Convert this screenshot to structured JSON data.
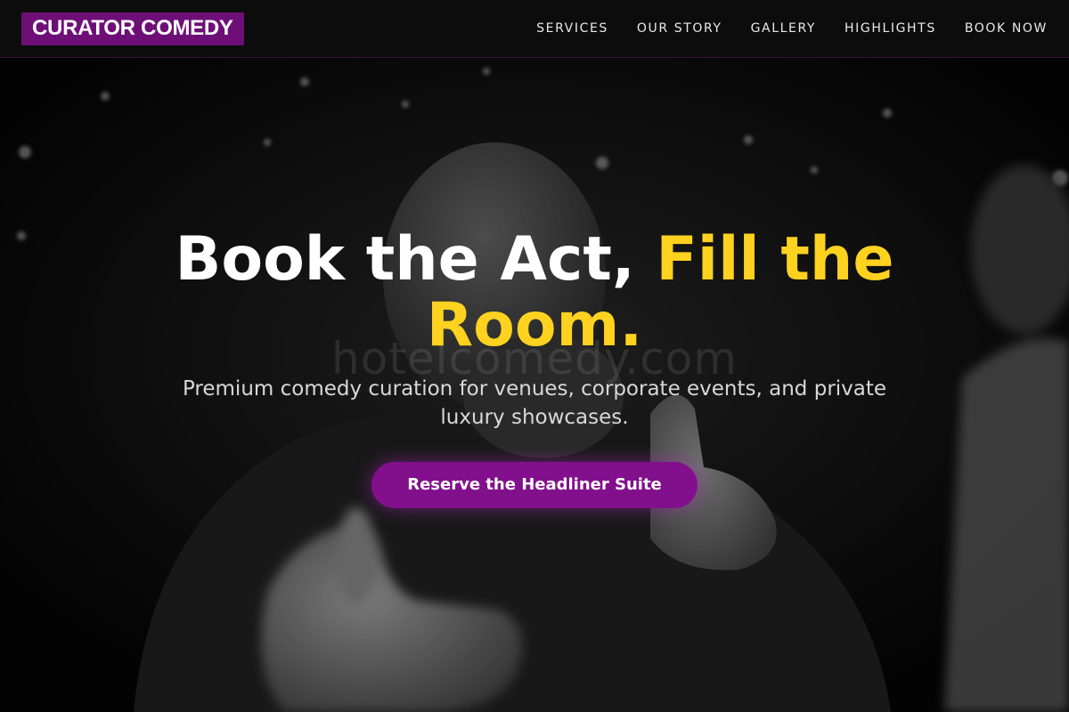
{
  "header": {
    "logo": "CURATOR COMEDY",
    "nav": [
      {
        "label": "SERVICES"
      },
      {
        "label": "OUR STORY"
      },
      {
        "label": "GALLERY"
      },
      {
        "label": "HIGHLIGHTS"
      },
      {
        "label": "BOOK NOW"
      }
    ]
  },
  "hero": {
    "watermark": "hotelcomedy.com",
    "headline_part1": "Book the Act, ",
    "headline_accent": "Fill the Room.",
    "subhead": "Premium comedy curation for venues, corporate events, and private luxury showcases.",
    "cta_label": "Reserve the Headliner Suite"
  },
  "colors": {
    "brand_purple": "#6e0f78",
    "cta_purple": "#82108c",
    "accent_yellow": "#ffd21f",
    "nav_bg": "#0c0c0c"
  }
}
